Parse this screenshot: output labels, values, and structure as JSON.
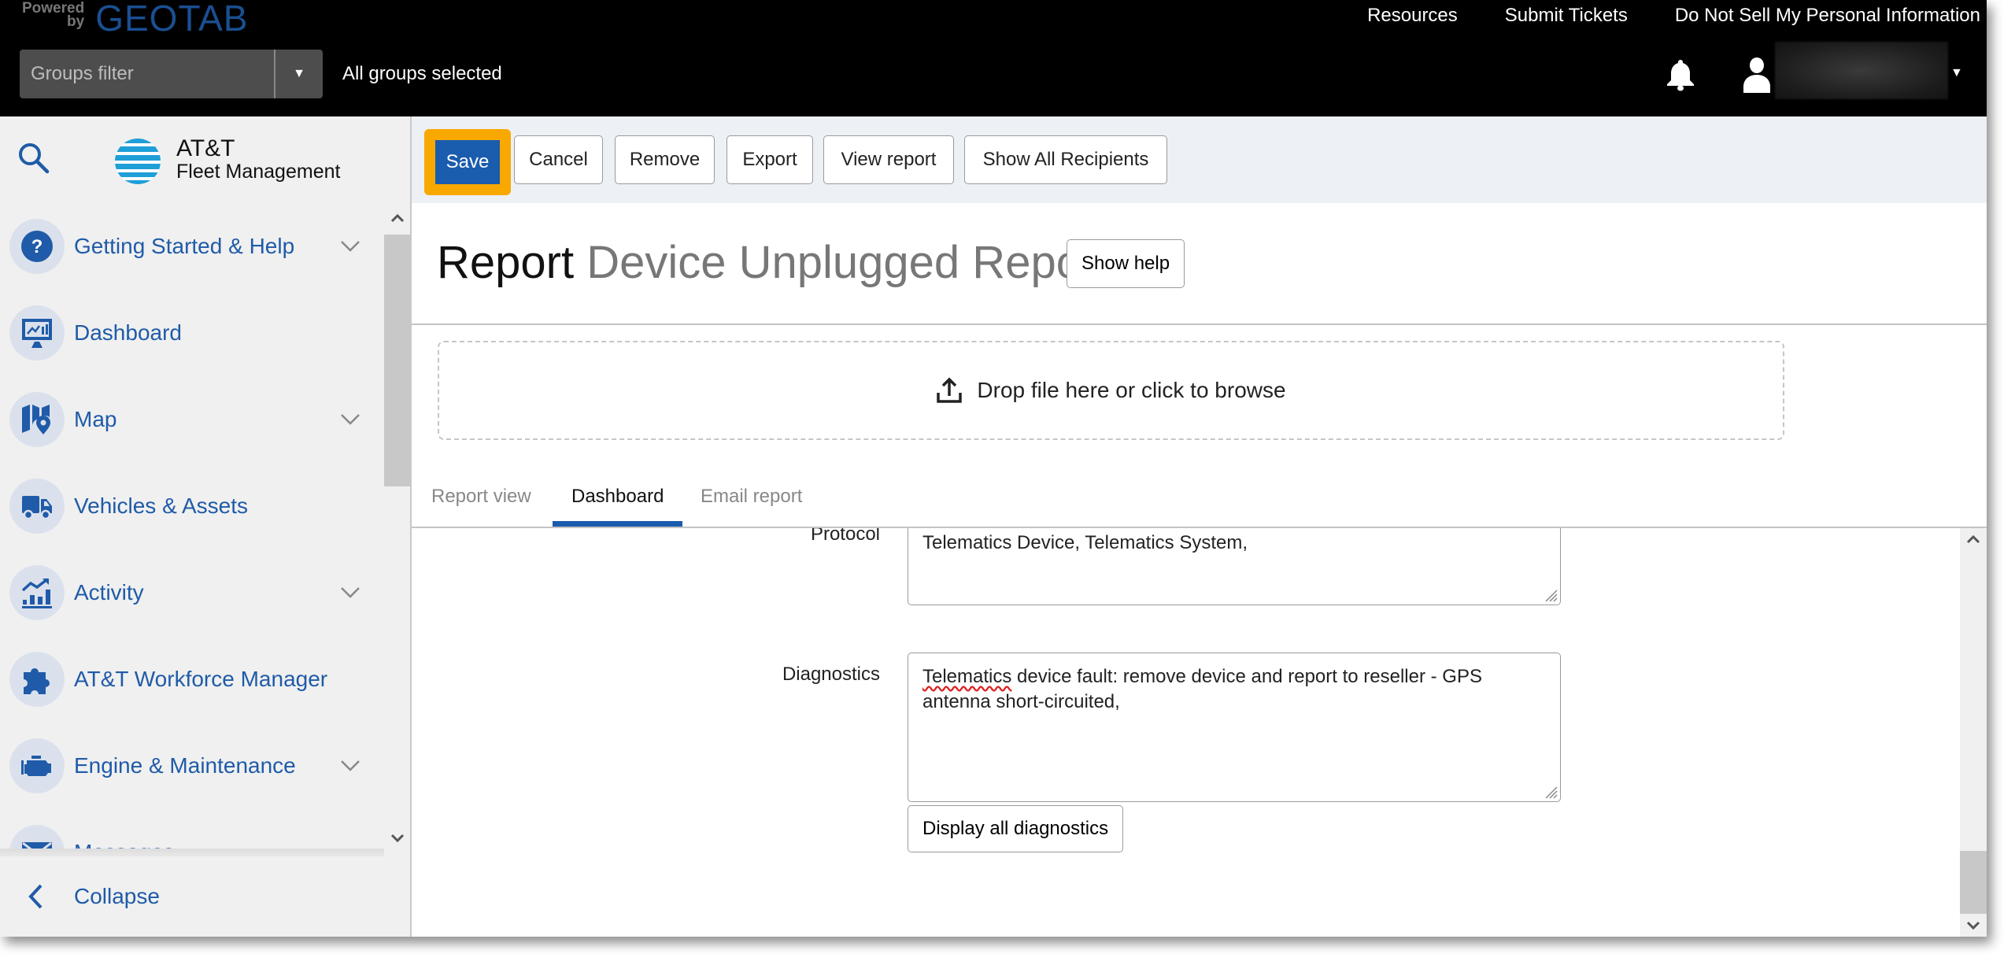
{
  "header": {
    "powered_by": "Powered by",
    "brand": "GEOTAB",
    "links": [
      "Resources",
      "Submit Tickets",
      "Do Not Sell My Personal Information"
    ],
    "groups_filter": {
      "placeholder": "Groups filter",
      "status": "All groups selected"
    },
    "icons": {
      "notifications": "bell-icon",
      "user": "user-icon"
    }
  },
  "sidebar": {
    "logo": {
      "line1": "AT&T",
      "line2": "Fleet Management"
    },
    "items": [
      {
        "label": "Getting Started & Help",
        "icon": "help-icon",
        "expandable": true
      },
      {
        "label": "Dashboard",
        "icon": "dashboard-icon",
        "expandable": false
      },
      {
        "label": "Map",
        "icon": "map-icon",
        "expandable": true
      },
      {
        "label": "Vehicles & Assets",
        "icon": "truck-icon",
        "expandable": false
      },
      {
        "label": "Activity",
        "icon": "activity-icon",
        "expandable": true
      },
      {
        "label": "AT&T Workforce Manager",
        "icon": "puzzle-icon",
        "expandable": false
      },
      {
        "label": "Engine & Maintenance",
        "icon": "engine-icon",
        "expandable": true
      },
      {
        "label": "Messages",
        "icon": "envelope-icon",
        "expandable": false
      }
    ],
    "collapse_label": "Collapse"
  },
  "toolbar": {
    "save": "Save",
    "cancel": "Cancel",
    "remove": "Remove",
    "export": "Export",
    "view_report": "View report",
    "show_all_recipients": "Show All Recipients"
  },
  "page": {
    "title_prefix": "Report",
    "title_name": "Device Unplugged Report",
    "show_help": "Show help"
  },
  "dropzone": {
    "label": "Drop file here or click to browse"
  },
  "tabs": [
    {
      "label": "Report view",
      "active": false
    },
    {
      "label": "Dashboard",
      "active": true
    },
    {
      "label": "Email report",
      "active": false
    }
  ],
  "form": {
    "protocol": {
      "label": "Protocol",
      "value": "Telematics Device, Telematics System,"
    },
    "diagnostics": {
      "label": "Diagnostics",
      "value_word1": "Telematics",
      "value_rest": " device fault: remove device and report to reseller - GPS antenna short-circuited,"
    },
    "display_all_diagnostics": "Display all diagnostics"
  },
  "colors": {
    "accent_blue": "#1a5cad",
    "save_focus_ring": "#f9a800",
    "nav_text": "#1f5ba8",
    "header_bg": "#000000"
  }
}
